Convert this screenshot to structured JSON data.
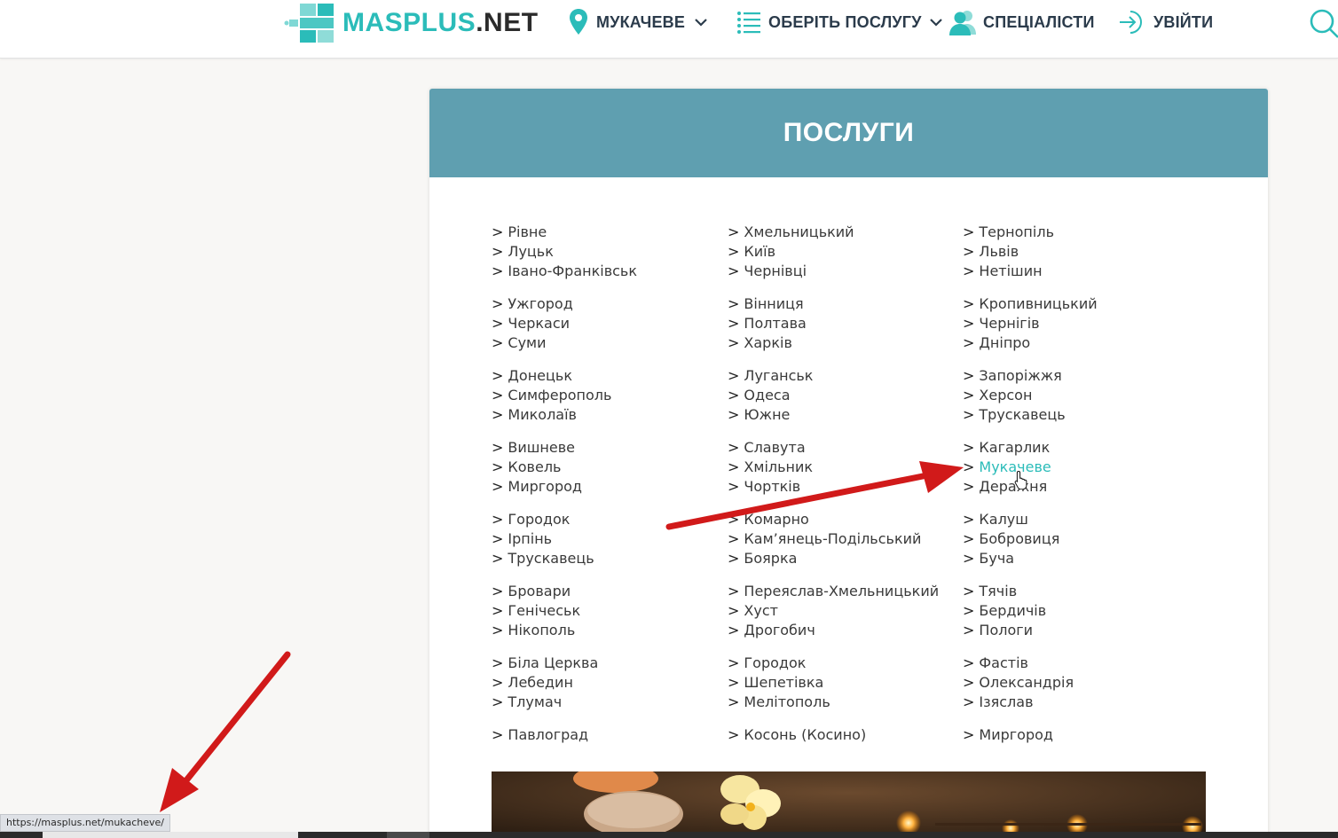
{
  "header": {
    "logo_text_main": "MASPLUS",
    "logo_text_suffix": ".NET",
    "city_label": "МУКАЧЕВЕ",
    "services_label": "ОБЕРІТЬ ПОСЛУГУ",
    "specialists_label": "СПЕЦІАЛІСТИ",
    "login_label": "УВІЙТИ",
    "icons": [
      "location-pin-icon",
      "chevron-down-icon",
      "list-icon",
      "users-icon",
      "login-arrow-icon",
      "search-icon"
    ]
  },
  "panel": {
    "title": "ПОСЛУГИ"
  },
  "city_prefix": ">",
  "columns": [
    {
      "groups": [
        [
          "Рівне",
          "Луцьк",
          "Івано-Франківськ"
        ],
        [
          "Ужгород",
          "Черкаси",
          "Суми"
        ],
        [
          "Донецьк",
          "Симферополь",
          "Миколаїв"
        ],
        [
          "Вишневе",
          "Ковель",
          "Миргород"
        ],
        [
          "Городок",
          "Ірпінь",
          "Трускавець"
        ],
        [
          "Бровари",
          "Генічеськ",
          "Нікополь"
        ],
        [
          "Біла Церква",
          "Лебедин",
          "Тлумач"
        ],
        [
          "Павлоград"
        ]
      ]
    },
    {
      "groups": [
        [
          "Хмельницький",
          "Київ",
          "Чернівці"
        ],
        [
          "Вінниця",
          "Полтава",
          "Харків"
        ],
        [
          "Луганськ",
          "Одеса",
          "Южне"
        ],
        [
          "Славута",
          "Хмільник",
          "Чортків"
        ],
        [
          "Комарно",
          "Кам’янець-Подільський",
          "Боярка"
        ],
        [
          "Переяслав-Хмельницький",
          "Хуст",
          "Дрогобич"
        ],
        [
          "Городок",
          "Шепетівка",
          "Мелітополь"
        ],
        [
          "Косонь (Косино)"
        ]
      ]
    },
    {
      "groups": [
        [
          "Тернопіль",
          "Львів",
          "Нетішин"
        ],
        [
          "Кропивницький",
          "Чернігів",
          "Дніпро"
        ],
        [
          "Запоріжжя",
          "Херсон",
          "Трускавець"
        ],
        [
          "Кагарлик",
          "Мукачеве",
          "Деражня"
        ],
        [
          "Калуш",
          "Бобровиця",
          "Буча"
        ],
        [
          "Тячів",
          "Бердичів",
          "Пологи"
        ],
        [
          "Фастів",
          "Олександрія",
          "Ізяслав"
        ],
        [
          "Миргород"
        ]
      ]
    }
  ],
  "active_city": "Мукачеве",
  "status_bar_url": "https://masplus.net/mukacheve/",
  "colors": {
    "accent": "#2bbcb9",
    "panel_header": "#5f9fb0",
    "annotation_arrow": "#d11a1a",
    "nav_text": "#2b3b4b"
  }
}
